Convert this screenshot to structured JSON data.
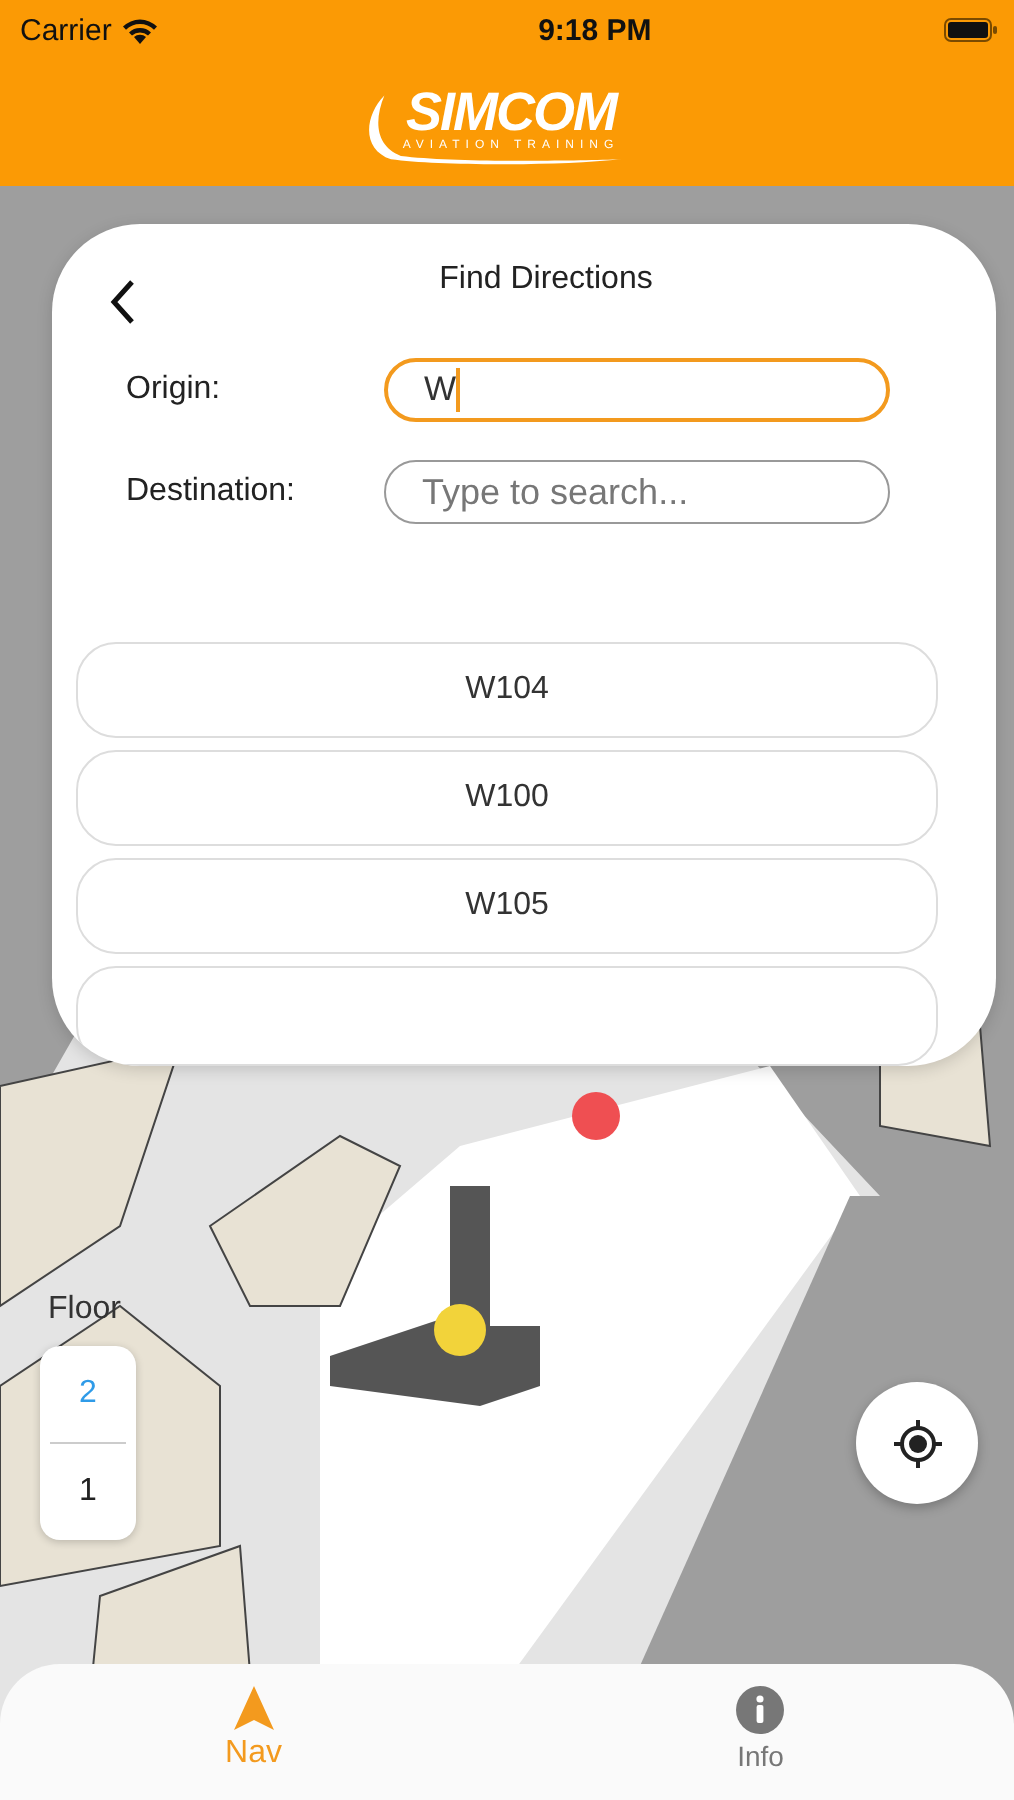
{
  "status_bar": {
    "carrier": "Carrier",
    "time": "9:18 PM"
  },
  "header": {
    "logo": {
      "name": "SIMCOM",
      "tagline": "AVIATION TRAINING"
    }
  },
  "directions": {
    "title": "Find Directions",
    "fields": [
      {
        "label": "Origin:",
        "value": "W",
        "focused": true
      },
      {
        "label": "Destination:",
        "placeholder": "Type to search...",
        "focused": false
      }
    ],
    "results": [
      "W104",
      "W100",
      "W105"
    ]
  },
  "floor_picker": {
    "label": "Floor",
    "floors": [
      {
        "label": "2",
        "selected": true
      },
      {
        "label": "1",
        "selected": false
      }
    ]
  },
  "tab_bar": [
    {
      "label": "Nav",
      "kind": "nav",
      "selected": true
    },
    {
      "label": "Info",
      "kind": "info",
      "selected": false
    }
  ]
}
